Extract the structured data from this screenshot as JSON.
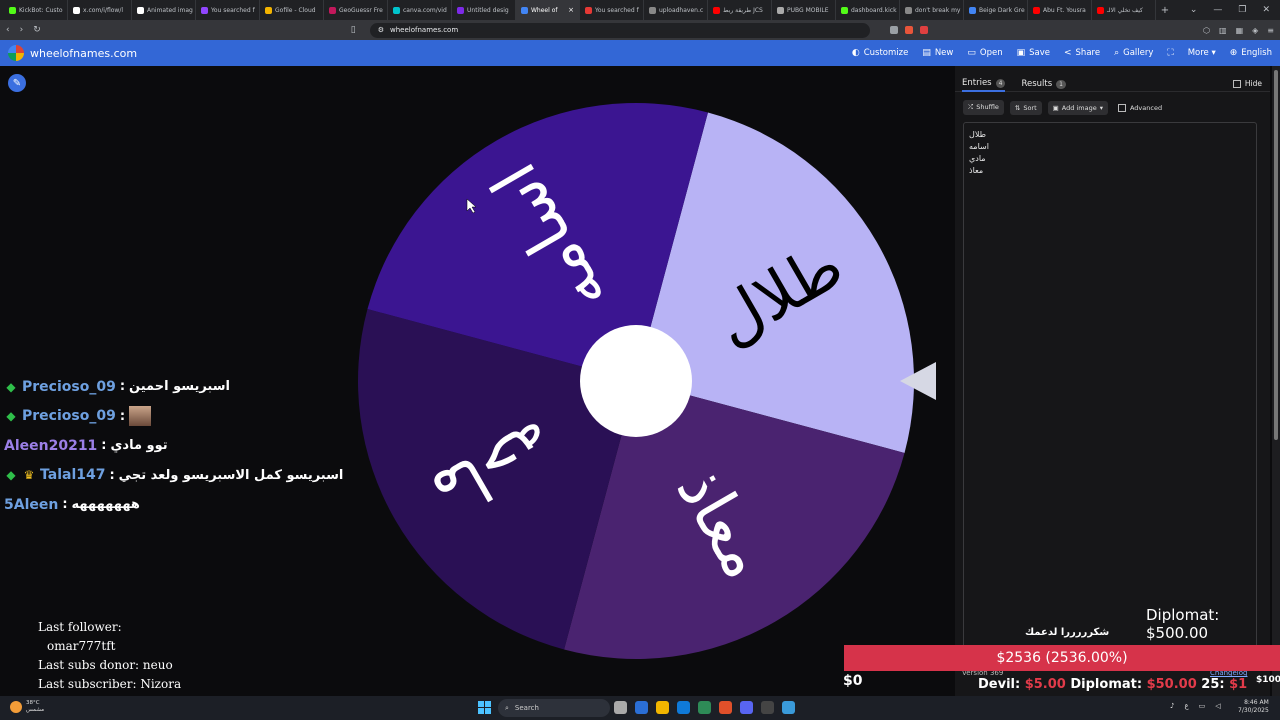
{
  "browser": {
    "tabs": [
      {
        "label": "KickBot: Custo",
        "color": "#53fc18"
      },
      {
        "label": "x.com/i/flow/l",
        "color": "#ffffff"
      },
      {
        "label": "Animated imag",
        "color": "#ffffff"
      },
      {
        "label": "You searched f",
        "color": "#9146ff"
      },
      {
        "label": "Gofile - Cloud",
        "color": "#f4b400"
      },
      {
        "label": "GeoGuessr Fre",
        "color": "#c2185b"
      },
      {
        "label": "canva.com/vid",
        "color": "#00c4cc"
      },
      {
        "label": "Untitled desig",
        "color": "#7d2ae8"
      },
      {
        "label": "Wheel of",
        "color": "#4285f4"
      },
      {
        "label": "You searched f",
        "color": "#e53935"
      },
      {
        "label": "uploadhaven.c",
        "color": "#888888"
      },
      {
        "label": "طريقة ربط JCS",
        "color": "#ff0000"
      },
      {
        "label": "PUBG MOBILE",
        "color": "#aaaaaa"
      },
      {
        "label": "dashboard.kick",
        "color": "#53fc18"
      },
      {
        "label": "don't break my",
        "color": "#888888"
      },
      {
        "label": "Beige Dark Gre",
        "color": "#4285f4"
      },
      {
        "label": "Abu Ft. Yousra",
        "color": "#ff0000"
      },
      {
        "label": "كيف تخلي الالـ",
        "color": "#ff0000"
      }
    ],
    "active_tab_index": 8,
    "url": "wheelofnames.com"
  },
  "app": {
    "site_name": "wheelofnames.com",
    "menu": [
      {
        "icon": "◐",
        "label": "Customize"
      },
      {
        "icon": "▤",
        "label": "New"
      },
      {
        "icon": "▭",
        "label": "Open"
      },
      {
        "icon": "▣",
        "label": "Save"
      },
      {
        "icon": "<",
        "label": "Share"
      },
      {
        "icon": "⌕",
        "label": "Gallery"
      },
      {
        "icon": "⛶",
        "label": ""
      },
      {
        "icon": "",
        "label": "More ▾"
      },
      {
        "icon": "⊕",
        "label": "English"
      }
    ]
  },
  "wheel": {
    "segments": [
      {
        "label": "طلال",
        "color": "#b8b3f5",
        "text_color": "#000000"
      },
      {
        "label": "معاذ",
        "color": "#4a2370",
        "text_color": "#ffffff"
      },
      {
        "label": "ماحه",
        "color": "#2a1055",
        "text_color": "#ffffff"
      },
      {
        "label": "اسامه",
        "color": "#3b1591",
        "text_color": "#ffffff"
      }
    ]
  },
  "chat": [
    {
      "badges": [
        "diamond"
      ],
      "user": "Precioso_09",
      "user_color": "#6ea0e0",
      "message": "اسبريسو احمين",
      "emote": false
    },
    {
      "badges": [
        "diamond"
      ],
      "user": "Precioso_09",
      "user_color": "#6ea0e0",
      "message": "",
      "emote": true
    },
    {
      "badges": [],
      "user": "Aleen20211",
      "user_color": "#9b7fe6",
      "message": "توو مادي",
      "emote": false
    },
    {
      "badges": [
        "diamond",
        "crown"
      ],
      "user": "Talal147",
      "user_color": "#6ea0e0",
      "message": "اسبريسو كمل الاسبريسو ولعد تجي",
      "emote": false
    },
    {
      "badges": [],
      "user": "5Aleen",
      "user_color": "#6ea0e0",
      "message": "هههههههه",
      "emote": false
    }
  ],
  "stats": {
    "follower_label": "Last follower:",
    "follower_name": "omar777tft",
    "subs_donor": "Last subs donor: neuo",
    "subscriber": "Last subscriber: Nizora"
  },
  "panel": {
    "tabs": [
      {
        "label": "Entries",
        "count": "4"
      },
      {
        "label": "Results",
        "count": "1"
      }
    ],
    "hide_label": "Hide",
    "tools": {
      "shuffle": "Shuffle",
      "sort": "Sort",
      "add_image": "Add image",
      "advanced": "Advanced"
    },
    "entries": [
      "طلال",
      "اسامه",
      "مادي",
      "معاذ"
    ],
    "version": "Version 369",
    "changelog": "Changelog"
  },
  "overlay": {
    "thanks": "شكرررررا لدعمك",
    "diplomat_big": "Diplomat: $500.00",
    "goal": "$2536 (2536.00%)",
    "zero": "$0",
    "ticker": [
      {
        "name": "Devil:",
        "amount": "$5.00"
      },
      {
        "name": "Diplomat:",
        "amount": "$50.00"
      },
      {
        "name": "25:",
        "amount": "$1"
      }
    ],
    "hundred": "$100"
  },
  "taskbar": {
    "temp": "38°C",
    "weather_desc": "مشمس",
    "search": "Search",
    "time": "8:46 AM",
    "date": "7/30/2025"
  }
}
